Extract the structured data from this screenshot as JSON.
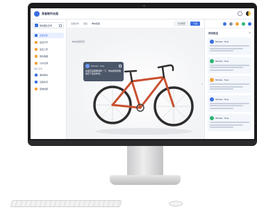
{
  "app": {
    "title": "观者制作台面"
  },
  "topbar": {
    "icons": [
      "settings-icon",
      "theme-toggle-icon"
    ]
  },
  "sidebar": {
    "workspace": "我的团队空间",
    "items_top": [
      {
        "label": "全部文件",
        "color": "#3b6fe0",
        "active": true
      },
      {
        "label": "最近打开",
        "color": "#f2a33a",
        "active": false
      },
      {
        "label": "最近上传",
        "color": "#f2a33a",
        "active": false
      },
      {
        "label": "我的收藏",
        "color": "#f2a33a",
        "active": false
      },
      {
        "label": "分享记录",
        "color": "#f2a33a",
        "active": false
      }
    ],
    "section": "团队空间",
    "items_team": [
      {
        "label": "素材库房",
        "color": "#3b6fe0"
      },
      {
        "label": "渲染队列",
        "color": "#3b6fe0"
      },
      {
        "label": "回收站里",
        "color": "#f2a33a"
      }
    ]
  },
  "main": {
    "breadcrumbs": [
      "全部文件",
      "项目",
      "单车模型"
    ],
    "buttons": {
      "share": "分享预览",
      "primary": "下载"
    },
    "canvas_tag": "单车模型预览",
    "tooltip": {
      "name": "Michael · Note",
      "body": "车座高度需要调整一下，整车模型视角保存下来供参考。"
    }
  },
  "panel": {
    "title": "评论批注",
    "tools": [
      {
        "icon": "eye-icon",
        "color": "#3b6fe0"
      },
      {
        "icon": "pin-icon",
        "color": "#8a93a6"
      },
      {
        "icon": "user-icon",
        "color": "#f2a33a"
      },
      {
        "icon": "info-icon",
        "color": "#2bb673"
      },
      {
        "icon": "chat-icon",
        "color": "#3b6fe0"
      }
    ],
    "comments": [
      {
        "name": "Michael · Note",
        "color": "#3b6fe0"
      },
      {
        "name": "Michael · Note",
        "color": "#2bb673"
      },
      {
        "name": "Michael · Note",
        "color": "#f2a33a"
      },
      {
        "name": "Michael · Note",
        "color": "#3b6fe0"
      },
      {
        "name": "Michael · Note",
        "color": "#2bb673"
      }
    ]
  }
}
